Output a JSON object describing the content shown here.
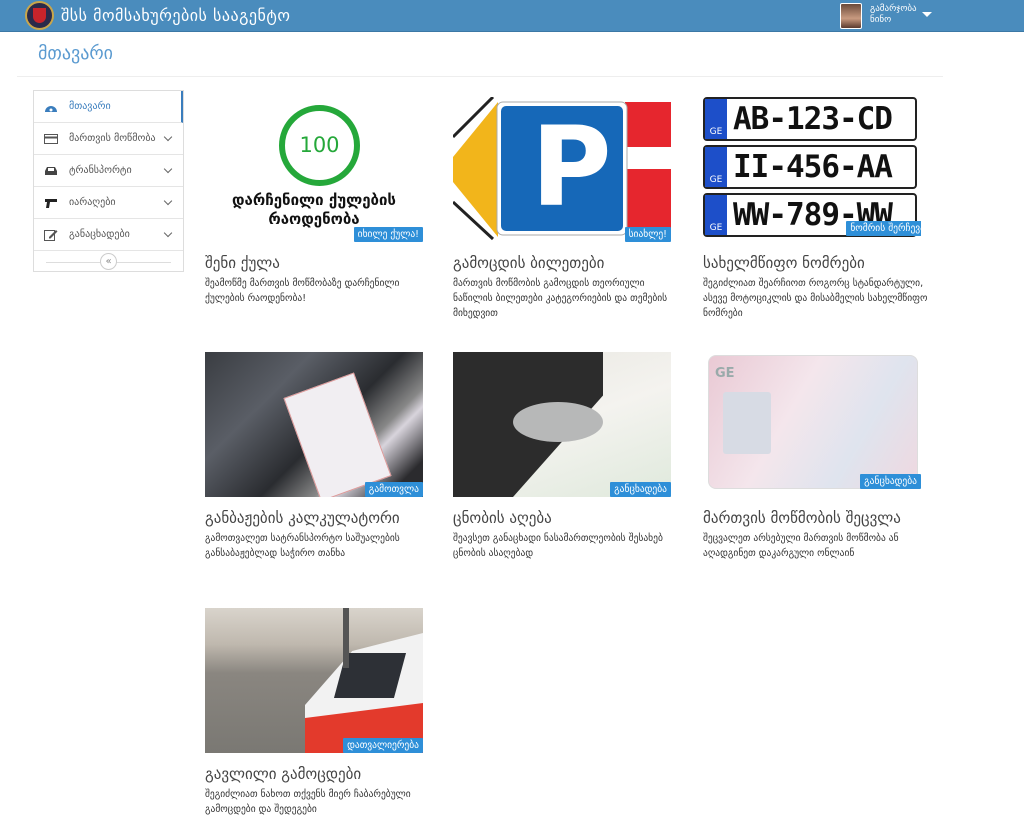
{
  "header": {
    "title": "შსს მომსახურების სააგენტო",
    "greeting": "გამარჯობა",
    "user": "ნინო"
  },
  "page_title": "მთავარი",
  "sidebar": {
    "items": [
      {
        "label": "მთავარი",
        "icon": "dashboard-icon"
      },
      {
        "label": "მართვის მოწმობა",
        "icon": "card-icon"
      },
      {
        "label": "ტრანსპორტი",
        "icon": "car-icon"
      },
      {
        "label": "იარაღები",
        "icon": "gun-icon"
      },
      {
        "label": "განაცხადები",
        "icon": "edit-icon"
      }
    ]
  },
  "cards": [
    {
      "title": "შენი ქულა",
      "desc": "შეამოწმე მართვის მოწმობაზე დარჩენილი ქულების რაოდენობა!",
      "badge": "იხილე ქულა!",
      "score": "100",
      "score_label": "დარჩენილი ქულების რაოდენობა"
    },
    {
      "title": "გამოცდის ბილეთები",
      "desc": "მართვის მოწმობის გამოცდის თეორიული ნაწილის ბილეთები კატეგორიების და თემების მიხედვით",
      "badge": "სიახლე!",
      "sign": "P"
    },
    {
      "title": "სახელმწიფო ნომრები",
      "desc": "შეგიძლიათ შეარჩიოთ როგორც სტანდარტული, ასევე მოტოციკლის და მისაბმელის სახელმწიფო ნომრები",
      "badge": "ნომრის შერჩევა",
      "plates": [
        "AB-123-CD",
        "II-456-AA",
        "WW-789-WW"
      ],
      "plate_country": "GE"
    },
    {
      "title": "განბაჟების კალკულატორი",
      "desc": "გამოთვალეთ სატრანსპორტო საშუალების განსაბაჟებლად საჭირო თანხა",
      "badge": "გამოთვლა"
    },
    {
      "title": "ცნობის აღება",
      "desc": "შეავსეთ განაცხადი ნასამართლეობის შესახებ ცნობის ასაღებად",
      "badge": "განცხადება"
    },
    {
      "title": "მართვის მოწმობის შეცვლა",
      "desc": "შეცვალეთ არსებული მართვის მოწმობა ან აღადგინეთ დაკარგული ონლაინ",
      "badge": "განცხადება",
      "license_text": "GE"
    },
    {
      "title": "გავლილი გამოცდები",
      "desc": "შეგიძლიათ ნახოთ თქვენს მიერ ჩაბარებული გამოცდები და შედეგები",
      "badge": "დათვალიერება"
    }
  ]
}
